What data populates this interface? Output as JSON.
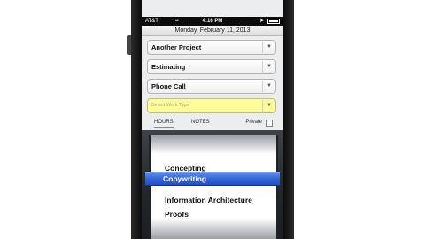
{
  "status_bar": {
    "carrier": "AT&T",
    "time": "4:16 PM"
  },
  "date_header": "Monday, February 11, 2013",
  "fields": [
    {
      "value": "Another Project"
    },
    {
      "value": "Estimating"
    },
    {
      "value": "Phone Call"
    }
  ],
  "work_type": {
    "placeholder": "Select Work Type"
  },
  "tabs": {
    "hours": "HOURS",
    "notes": "NOTES",
    "active": "hours"
  },
  "private_label": "Private",
  "picker": {
    "options": [
      "Concepting",
      "Copywriting",
      "Information Architecture",
      "Proofs"
    ],
    "selected": "Copywriting"
  },
  "colors": {
    "selection": "#2f64d6",
    "work_type_field": "#fffd9a"
  }
}
